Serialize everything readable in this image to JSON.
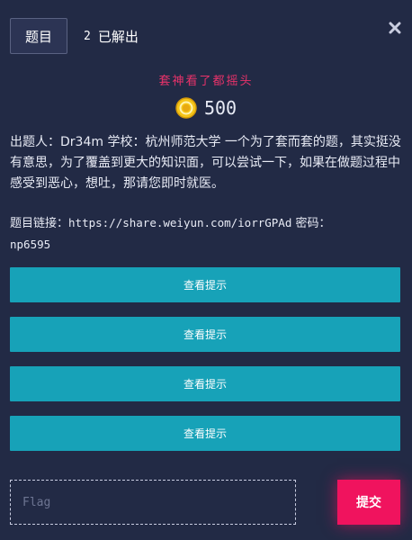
{
  "header": {
    "active_tab_label": "题目",
    "solved_count": "2",
    "solved_label": "已解出",
    "close_icon": "close-icon"
  },
  "challenge": {
    "subtitle": "套神看了都摇头",
    "points_icon": "coin-icon",
    "points": "500",
    "description": "出题人：Dr34m 学校：杭州师范大学 一个为了套而套的题，其实挺没有意思，为了覆盖到更大的知识面，可以尝试一下，如果在做题过程中感受到恶心，想吐，那请您即时就医。",
    "link_label": "题目链接：",
    "link_url": "https://share.weiyun.com/iorrGPAd",
    "password_label": " 密码：",
    "password": "np6595"
  },
  "hints": [
    {
      "label": "查看提示"
    },
    {
      "label": "查看提示"
    },
    {
      "label": "查看提示"
    },
    {
      "label": "查看提示"
    }
  ],
  "flag_form": {
    "placeholder": "Flag",
    "value": "",
    "submit_label": "提交"
  },
  "colors": {
    "background": "#222a45",
    "accent_pink": "#f0135e",
    "subtitle_red": "#e8326a",
    "hint_teal": "#17a2b8",
    "coin_gold": "#f5c518"
  }
}
